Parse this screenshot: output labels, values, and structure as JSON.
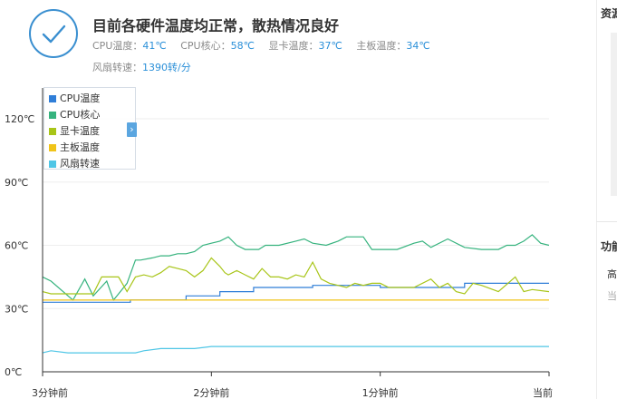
{
  "summary": {
    "status_title": "目前各硬件温度均正常，散热情况良好",
    "readings": [
      {
        "label": "CPU温度：",
        "value": "41℃"
      },
      {
        "label": "CPU核心：",
        "value": "58℃"
      },
      {
        "label": "显卡温度：",
        "value": "37℃"
      },
      {
        "label": "主板温度：",
        "value": "34℃"
      }
    ],
    "fan": {
      "label": "风扇转速：",
      "value": "1390转/分"
    },
    "check_color": "#3a8fd0"
  },
  "right_panel": {
    "section1_title": "资源",
    "section2_title": "功能",
    "item1": "高",
    "item2": "当"
  },
  "legend_toggle_icon": "chevron-right-icon",
  "chart_data": {
    "type": "line",
    "x_tick_labels": [
      "3分钟前",
      "2分钟前",
      "1分钟前",
      "当前"
    ],
    "y_tick_labels": [
      "0℃",
      "30℃",
      "60℃",
      "90℃",
      "120℃"
    ],
    "ylim": [
      0,
      120
    ],
    "y_ticks": [
      0,
      30,
      60,
      90,
      120
    ],
    "x_ticks": [
      0,
      1,
      2,
      3
    ],
    "grid": true,
    "legend_position": "top-left",
    "series": [
      {
        "name": "CPU温度",
        "color": "#2f7ed8",
        "x": [
          0,
          0.52,
          0.52,
          0.85,
          0.85,
          1.05,
          1.05,
          1.25,
          1.25,
          1.6,
          1.6,
          2.0,
          2.0,
          2.5,
          2.5,
          3.0
        ],
        "y": [
          33,
          33,
          34,
          34,
          36,
          36,
          38,
          38,
          40,
          40,
          41,
          41,
          40,
          40,
          42,
          42
        ]
      },
      {
        "name": "CPU核心",
        "color": "#36b37e",
        "x": [
          0,
          0.05,
          0.18,
          0.25,
          0.3,
          0.38,
          0.42,
          0.5,
          0.55,
          0.58,
          0.65,
          0.7,
          0.75,
          0.8,
          0.85,
          0.9,
          0.95,
          1.0,
          1.05,
          1.1,
          1.15,
          1.2,
          1.28,
          1.32,
          1.4,
          1.5,
          1.55,
          1.6,
          1.68,
          1.75,
          1.8,
          1.9,
          1.95,
          2.0,
          2.05,
          2.1,
          2.2,
          2.25,
          2.3,
          2.4,
          2.5,
          2.6,
          2.7,
          2.75,
          2.8,
          2.85,
          2.9,
          2.95,
          3.0
        ],
        "y": [
          45,
          43,
          34,
          44,
          36,
          43,
          34,
          42,
          53,
          53,
          54,
          55,
          55,
          56,
          56,
          57,
          60,
          61,
          62,
          64,
          60,
          58,
          58,
          60,
          60,
          62,
          63,
          61,
          60,
          62,
          64,
          64,
          58,
          58,
          58,
          58,
          61,
          62,
          59,
          63,
          59,
          58,
          58,
          60,
          60,
          62,
          65,
          61,
          60
        ]
      },
      {
        "name": "显卡温度",
        "color": "#a8c518",
        "x": [
          0,
          0.05,
          0.3,
          0.35,
          0.45,
          0.5,
          0.55,
          0.6,
          0.65,
          0.7,
          0.75,
          0.8,
          0.85,
          0.9,
          0.95,
          1.0,
          1.05,
          1.08,
          1.1,
          1.15,
          1.2,
          1.25,
          1.3,
          1.35,
          1.4,
          1.45,
          1.5,
          1.55,
          1.6,
          1.65,
          1.7,
          1.75,
          1.8,
          1.85,
          1.9,
          1.95,
          2.0,
          2.05,
          2.1,
          2.2,
          2.3,
          2.35,
          2.4,
          2.45,
          2.5,
          2.55,
          2.6,
          2.7,
          2.8,
          2.85,
          2.9,
          3.0
        ],
        "y": [
          38,
          37,
          37,
          45,
          45,
          38,
          45,
          46,
          45,
          47,
          50,
          49,
          48,
          45,
          48,
          54,
          50,
          47,
          46,
          48,
          46,
          44,
          49,
          45,
          45,
          44,
          46,
          45,
          52,
          44,
          42,
          41,
          40,
          42,
          41,
          42,
          42,
          40,
          40,
          40,
          44,
          40,
          42,
          38,
          37,
          42,
          41,
          38,
          45,
          38,
          39,
          38
        ]
      },
      {
        "name": "主板温度",
        "color": "#f0c419",
        "x": [
          0,
          3.0
        ],
        "y": [
          34,
          34
        ]
      },
      {
        "name": "风扇转速",
        "color": "#4fc6e6",
        "x": [
          0,
          0.05,
          0.15,
          0.3,
          0.45,
          0.55,
          0.6,
          0.7,
          0.8,
          0.9,
          1.0,
          1.1,
          1.2,
          1.4,
          1.6,
          1.8,
          2.0,
          2.2,
          2.4,
          2.6,
          2.8,
          2.9,
          3.0
        ],
        "y": [
          9,
          10,
          9,
          9,
          9,
          9,
          10,
          11,
          11,
          11,
          12,
          12,
          12,
          12,
          12,
          12,
          12,
          12,
          12,
          12,
          12,
          12,
          12
        ]
      }
    ]
  }
}
